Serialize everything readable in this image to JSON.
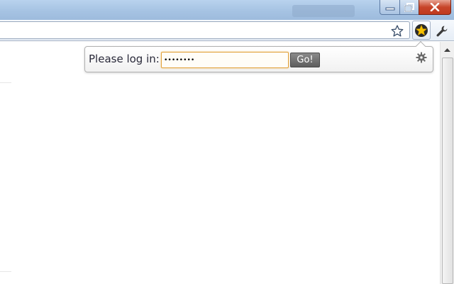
{
  "popup": {
    "prompt": "Please log in:",
    "password_value": "password",
    "go_label": "Go!"
  },
  "icons": {
    "bookmark": "star-outline-icon",
    "extension": "gold-star-icon",
    "menu": "wrench-icon",
    "settings": "gear-icon",
    "minimize": "minimize-icon",
    "restore": "restore-icon",
    "close": "close-icon",
    "scroll_up": "chevron-up-icon"
  },
  "colors": {
    "titlebar": "#a6c3e3",
    "close_button": "#c7452a",
    "input_focus_border": "#e1a23d",
    "go_button": "#6e6e6e",
    "extension_star": "#f5c000"
  }
}
